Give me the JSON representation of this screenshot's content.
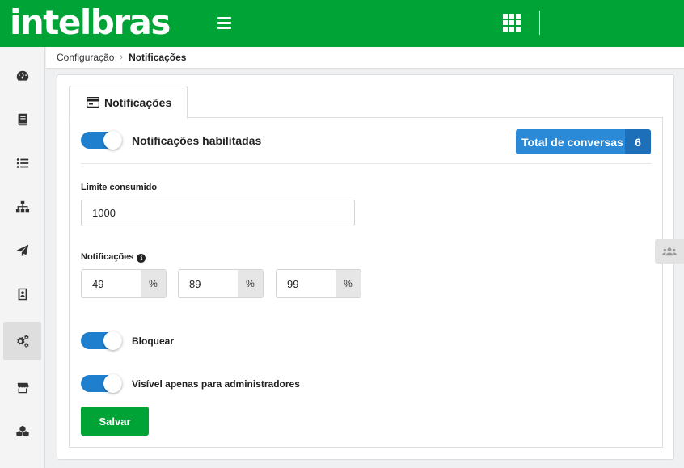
{
  "brand": {
    "logo_text": "intelbras",
    "color": "#00a335"
  },
  "topbar": {
    "menu_icon": "hamburger-icon",
    "apps_icon": "grid-apps-icon"
  },
  "sidebar": {
    "items": [
      {
        "icon": "dashboard-icon"
      },
      {
        "icon": "book-icon"
      },
      {
        "icon": "list-icon"
      },
      {
        "icon": "sitemap-icon"
      },
      {
        "icon": "paper-plane-icon"
      },
      {
        "icon": "contacts-icon"
      },
      {
        "icon": "cogs-icon",
        "active": true
      },
      {
        "icon": "store-icon"
      },
      {
        "icon": "cubes-icon"
      }
    ]
  },
  "breadcrumb": {
    "parent": "Configuração",
    "separator": "›",
    "current": "Notificações"
  },
  "tab": {
    "label": "Notificações",
    "icon": "card-icon"
  },
  "notifications": {
    "enabled_label": "Notificações habilitadas",
    "enabled": true,
    "total_label": "Total de conversas",
    "total_count": "6",
    "limit_label": "Limite consumido",
    "limit_value": "1000",
    "thresholds_label": "Notificações",
    "info_glyph": "i",
    "thresholds": [
      {
        "value": "49",
        "unit": "%"
      },
      {
        "value": "89",
        "unit": "%"
      },
      {
        "value": "99",
        "unit": "%"
      }
    ],
    "block_label": "Bloquear",
    "block_enabled": true,
    "admins_only_label": "Visível apenas para administradores",
    "admins_only_enabled": true,
    "save_label": "Salvar"
  },
  "colors": {
    "toggle_on": "#1f7fcf",
    "badge": "#2b8ad8",
    "badge_count": "#1c6fb8",
    "save": "#00a335"
  }
}
